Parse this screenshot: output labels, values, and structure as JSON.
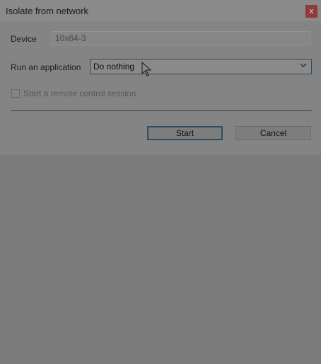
{
  "window": {
    "title": "Isolate from network",
    "close_glyph": "x"
  },
  "form": {
    "device_label": "Device",
    "device_value": "10x64-3",
    "run_label": "Run an application",
    "run_selected": "Do nothing",
    "remote_checkbox_label": "Start a remote control session"
  },
  "buttons": {
    "start": "Start",
    "cancel": "Cancel"
  },
  "icons": {
    "close": "close-icon",
    "dropdown": "chevron-down-icon",
    "pointer": "mouse-pointer-icon"
  },
  "colors": {
    "close_bg": "#8e3b3b",
    "focus_border": "#264d63"
  }
}
